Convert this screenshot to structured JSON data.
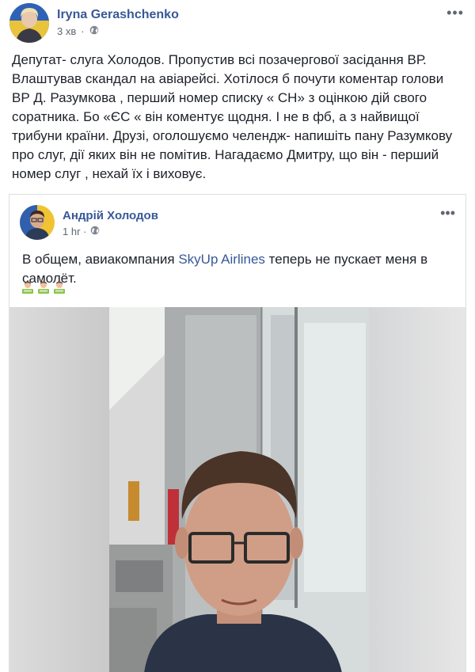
{
  "post": {
    "author": "Iryna Gerashchenko",
    "time": "3 хв",
    "privacy_icon": "globe-icon",
    "more_icon": "more-horizontal-icon",
    "text": "Депутат- слуга Холодов. Пропустив всі позачергової засідання ВР. Влаштував скандал на авіарейсі. Хотілося б почути коментар голови ВР Д. Разумкова , перший номер списку « СН» з оцінкою дій свого соратника. Бо «ЄС « він коментує щодня. І не в фб, а з найвищої трибуни країни. Друзі, оголошуємо челендж- напишіть пану Разумкову про слуг, дії яких він не помітив. Нагадаємо Дмитру, що він - перший номер слуг , нехай їх і виховує."
  },
  "shared_post": {
    "author": "Андрій Холодов",
    "time": "1 hr ·",
    "privacy_icon": "globe-icon",
    "more_icon": "more-horizontal-icon",
    "text_before": "В общем, авиакомпания ",
    "link_text": "SkyUp Airlines",
    "text_after": " теперь не пускает меня в самолёт.",
    "emoji_icon": "man-technologist-emoji-icon"
  },
  "colors": {
    "link": "#385898",
    "meta": "#606770",
    "border": "#dddfe2"
  }
}
